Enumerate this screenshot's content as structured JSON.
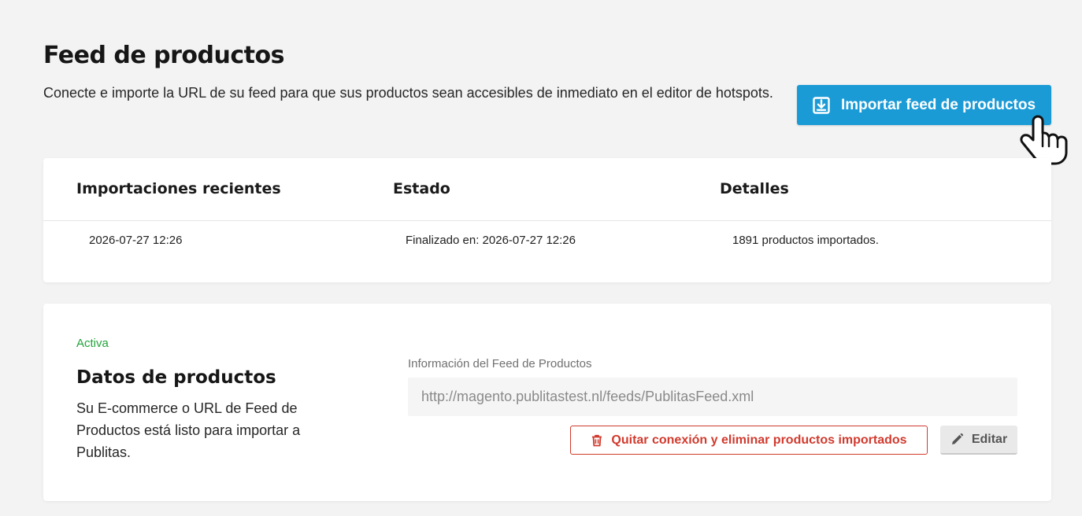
{
  "header": {
    "title": "Feed de productos",
    "description": "Conecte e importe la URL de su feed para que sus productos sean accesibles de inmediato en el editor de hotspots.",
    "import_button": {
      "label": "Importar feed de productos",
      "icon": "import-icon"
    }
  },
  "imports_table": {
    "columns": [
      "Importaciones recientes",
      "Estado",
      "Detalles"
    ],
    "rows": [
      {
        "date": "2026-07-27 12:26",
        "status": "Finalizado en: 2026-07-27 12:26",
        "details": "1891 productos importados."
      }
    ]
  },
  "feed_card": {
    "status": "Activa",
    "title": "Datos de productos",
    "description": "Su E-commerce o URL de Feed de Productos está listo para importar a Publitas.",
    "field_label": "Información del Feed de Productos",
    "feed_url": "http://magento.publitastest.nl/feeds/PublitasFeed.xml",
    "remove_button": {
      "label": "Quitar conexión y eliminar productos importados",
      "icon": "trash-icon"
    },
    "edit_button": {
      "label": "Editar",
      "icon": "pencil-icon"
    }
  },
  "colors": {
    "primary": "#1b9bd6",
    "active_status": "#22a43a",
    "danger": "#d13a2e",
    "background": "#f3f3f3"
  }
}
